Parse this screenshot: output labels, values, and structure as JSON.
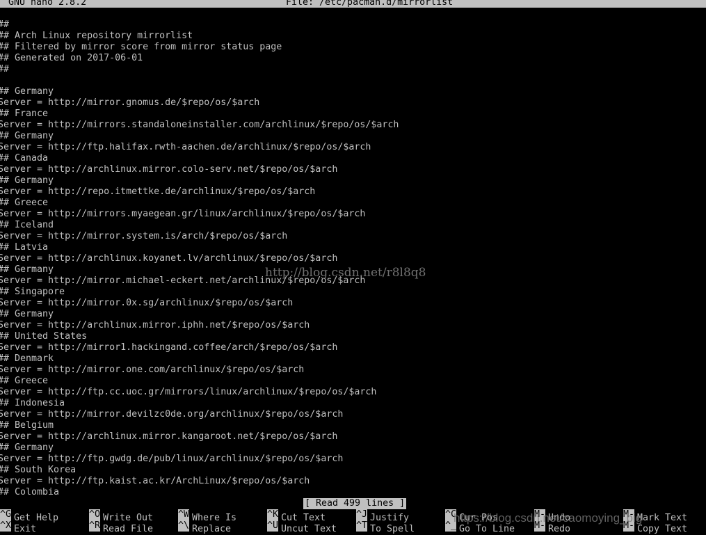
{
  "titlebar": {
    "app": "GNU nano 2.8.2",
    "file": "File: /etc/pacman.d/mirrorlist"
  },
  "lines": [
    "##",
    "## Arch Linux repository mirrorlist",
    "## Filtered by mirror score from mirror status page",
    "## Generated on 2017-06-01",
    "##",
    "",
    "## Germany",
    "Server = http://mirror.gnomus.de/$repo/os/$arch",
    "## France",
    "Server = http://mirrors.standaloneinstaller.com/archlinux/$repo/os/$arch",
    "## Germany",
    "Server = http://ftp.halifax.rwth-aachen.de/archlinux/$repo/os/$arch",
    "## Canada",
    "Server = http://archlinux.mirror.colo-serv.net/$repo/os/$arch",
    "## Germany",
    "Server = http://repo.itmettke.de/archlinux/$repo/os/$arch",
    "## Greece",
    "Server = http://mirrors.myaegean.gr/linux/archlinux/$repo/os/$arch",
    "## Iceland",
    "Server = http://mirror.system.is/arch/$repo/os/$arch",
    "## Latvia",
    "Server = http://archlinux.koyanet.lv/archlinux/$repo/os/$arch",
    "## Germany",
    "Server = http://mirror.michael-eckert.net/archlinux/$repo/os/$arch",
    "## Singapore",
    "Server = http://mirror.0x.sg/archlinux/$repo/os/$arch",
    "## Germany",
    "Server = http://archlinux.mirror.iphh.net/$repo/os/$arch",
    "## United States",
    "Server = http://mirror1.hackingand.coffee/arch/$repo/os/$arch",
    "## Denmark",
    "Server = http://mirror.one.com/archlinux/$repo/os/$arch",
    "## Greece",
    "Server = http://ftp.cc.uoc.gr/mirrors/linux/archlinux/$repo/os/$arch",
    "## Indonesia",
    "Server = http://mirror.devilzc0de.org/archlinux/$repo/os/$arch",
    "## Belgium",
    "Server = http://archlinux.mirror.kangaroot.net/$repo/os/$arch",
    "## Germany",
    "Server = http://ftp.gwdg.de/pub/linux/archlinux/$repo/os/$arch",
    "## South Korea",
    "Server = http://ftp.kaist.ac.kr/ArchLinux/$repo/os/$arch",
    "## Colombia"
  ],
  "status": "[ Read 499 lines ]",
  "shortcuts": [
    {
      "key": "^G",
      "label": "Get Help"
    },
    {
      "key": "^X",
      "label": "Exit"
    },
    {
      "key": "^O",
      "label": "Write Out"
    },
    {
      "key": "^R",
      "label": "Read File"
    },
    {
      "key": "^W",
      "label": "Where Is"
    },
    {
      "key": "^\\",
      "label": "Replace"
    },
    {
      "key": "^K",
      "label": "Cut Text"
    },
    {
      "key": "^U",
      "label": "Uncut Text"
    },
    {
      "key": "^J",
      "label": "Justify"
    },
    {
      "key": "^T",
      "label": "To Spell"
    },
    {
      "key": "^C",
      "label": "Cur Pos"
    },
    {
      "key": "^_",
      "label": "Go To Line"
    },
    {
      "key": "M-U",
      "label": "Undo"
    },
    {
      "key": "M-E",
      "label": "Redo"
    },
    {
      "key": "M-A",
      "label": "Mark Text"
    },
    {
      "key": "M-6",
      "label": "Copy Text"
    }
  ],
  "watermarks": {
    "center": "http://blog.csdn.net/r8l8q8",
    "bottom": "https://blog.csdn.net/caomoying_big"
  }
}
